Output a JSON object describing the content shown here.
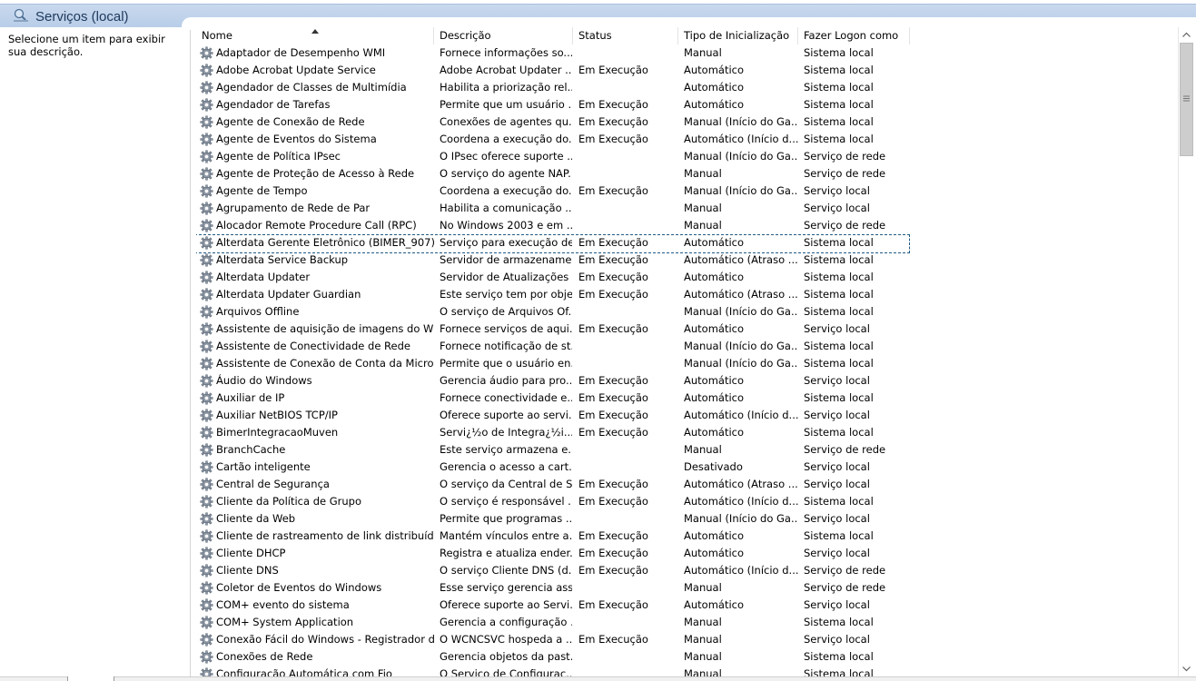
{
  "header": {
    "title": "Serviços (local)",
    "icon": "services-magnifier-icon"
  },
  "description_pane": {
    "text": "Selecione um item para exibir sua descrição."
  },
  "columns": [
    "Nome",
    "Descrição",
    "Status",
    "Tipo de Inicialização",
    "Fazer Logon como"
  ],
  "sort": {
    "column": "Nome",
    "direction": "ascending"
  },
  "rows": [
    {
      "name": "Adaptador de Desempenho WMI",
      "desc": "Fornece informações so...",
      "status": "",
      "start": "Manual",
      "logon": "Sistema local"
    },
    {
      "name": "Adobe Acrobat Update Service",
      "desc": "Adobe Acrobat Updater ...",
      "status": "Em Execução",
      "start": "Automático",
      "logon": "Sistema local"
    },
    {
      "name": "Agendador de Classes de Multimídia",
      "desc": "Habilita a priorização rel...",
      "status": "",
      "start": "Automático",
      "logon": "Sistema local"
    },
    {
      "name": "Agendador de Tarefas",
      "desc": "Permite que um usuário ...",
      "status": "Em Execução",
      "start": "Automático",
      "logon": "Sistema local"
    },
    {
      "name": "Agente de Conexão de Rede",
      "desc": "Conexões de agentes qu...",
      "status": "Em Execução",
      "start": "Manual (Início do Ga...",
      "logon": "Sistema local"
    },
    {
      "name": "Agente de Eventos do Sistema",
      "desc": "Coordena a execução do...",
      "status": "Em Execução",
      "start": "Automático (Início d...",
      "logon": "Sistema local"
    },
    {
      "name": "Agente de Política IPsec",
      "desc": "O IPsec oferece suporte ...",
      "status": "",
      "start": "Manual (Início do Ga...",
      "logon": "Serviço de rede"
    },
    {
      "name": "Agente de Proteção de Acesso à Rede",
      "desc": "O serviço do agente NAP...",
      "status": "",
      "start": "Manual",
      "logon": "Serviço de rede"
    },
    {
      "name": "Agente de Tempo",
      "desc": "Coordena a execução do...",
      "status": "Em Execução",
      "start": "Manual (Início do Ga...",
      "logon": "Serviço local"
    },
    {
      "name": "Agrupamento de Rede de Par",
      "desc": "Habilita a comunicação ...",
      "status": "",
      "start": "Manual",
      "logon": "Serviço local"
    },
    {
      "name": "Alocador Remote Procedure Call (RPC)",
      "desc": "No Windows 2003 e em ...",
      "status": "",
      "start": "Manual",
      "logon": "Serviço de rede"
    },
    {
      "name": "Alterdata Gerente Eletrônico (BIMER_907)",
      "desc": "Serviço para execução de...",
      "status": "Em Execução",
      "start": "Automático",
      "logon": "Sistema local",
      "focused": true
    },
    {
      "name": "Alterdata Service Backup",
      "desc": "Servidor de armazename...",
      "status": "Em Execução",
      "start": "Automático (Atraso ...",
      "logon": "Sistema local"
    },
    {
      "name": "Alterdata Updater",
      "desc": "Servidor de Atualizações ...",
      "status": "Em Execução",
      "start": "Automático",
      "logon": "Sistema local"
    },
    {
      "name": "Alterdata Updater Guardian",
      "desc": "Este serviço tem por obje...",
      "status": "Em Execução",
      "start": "Automático (Atraso ...",
      "logon": "Sistema local"
    },
    {
      "name": "Arquivos Offline",
      "desc": "O serviço de Arquivos Of...",
      "status": "",
      "start": "Manual (Início do Ga...",
      "logon": "Sistema local"
    },
    {
      "name": "Assistente de aquisição de imagens do Win...",
      "desc": "Fornece serviços de aqui...",
      "status": "Em Execução",
      "start": "Automático",
      "logon": "Serviço local"
    },
    {
      "name": "Assistente de Conectividade de Rede",
      "desc": "Fornece notificação de st...",
      "status": "",
      "start": "Manual (Início do Ga...",
      "logon": "Sistema local"
    },
    {
      "name": "Assistente de Conexão de Conta da Micros...",
      "desc": "Permite que o usuário en...",
      "status": "",
      "start": "Manual (Início do Ga...",
      "logon": "Sistema local"
    },
    {
      "name": "Áudio do Windows",
      "desc": "Gerencia áudio para pro...",
      "status": "Em Execução",
      "start": "Automático",
      "logon": "Serviço local"
    },
    {
      "name": "Auxiliar de IP",
      "desc": "Fornece conectividade e...",
      "status": "Em Execução",
      "start": "Automático",
      "logon": "Sistema local"
    },
    {
      "name": "Auxiliar NetBIOS TCP/IP",
      "desc": "Oferece suporte ao servi...",
      "status": "Em Execução",
      "start": "Automático (Início d...",
      "logon": "Serviço local"
    },
    {
      "name": "BimerIntegracaoMuven",
      "desc": "Servi¿½o de Integra¿½i...",
      "status": "Em Execução",
      "start": "Automático",
      "logon": "Sistema local"
    },
    {
      "name": "BranchCache",
      "desc": "Este serviço armazena e...",
      "status": "",
      "start": "Manual",
      "logon": "Serviço de rede"
    },
    {
      "name": "Cartão inteligente",
      "desc": "Gerencia o acesso a cart...",
      "status": "",
      "start": "Desativado",
      "logon": "Serviço local"
    },
    {
      "name": "Central de Segurança",
      "desc": "O serviço da Central de S...",
      "status": "Em Execução",
      "start": "Automático (Atraso ...",
      "logon": "Serviço local"
    },
    {
      "name": "Cliente da Política de Grupo",
      "desc": "O serviço é responsável ...",
      "status": "Em Execução",
      "start": "Automático (Início d...",
      "logon": "Sistema local"
    },
    {
      "name": "Cliente da Web",
      "desc": "Permite que programas ...",
      "status": "",
      "start": "Manual (Início do Ga...",
      "logon": "Serviço local"
    },
    {
      "name": "Cliente de rastreamento de link distribuído",
      "desc": "Mantém vínculos entre a...",
      "status": "Em Execução",
      "start": "Automático",
      "logon": "Sistema local"
    },
    {
      "name": "Cliente DHCP",
      "desc": "Registra e atualiza ender...",
      "status": "Em Execução",
      "start": "Automático",
      "logon": "Serviço local"
    },
    {
      "name": "Cliente DNS",
      "desc": "O serviço Cliente DNS (d...",
      "status": "Em Execução",
      "start": "Automático (Início d...",
      "logon": "Serviço de rede"
    },
    {
      "name": "Coletor de Eventos do Windows",
      "desc": "Esse serviço gerencia assi...",
      "status": "",
      "start": "Manual",
      "logon": "Serviço de rede"
    },
    {
      "name": "COM+ evento do sistema",
      "desc": "Oferece suporte ao Servi...",
      "status": "Em Execução",
      "start": "Automático",
      "logon": "Serviço local"
    },
    {
      "name": "COM+ System Application",
      "desc": "Gerencia a configuração ...",
      "status": "",
      "start": "Manual",
      "logon": "Sistema local"
    },
    {
      "name": "Conexão Fácil do Windows - Registrador de...",
      "desc": "O WCNCSVC hospeda a ...",
      "status": "Em Execução",
      "start": "Manual",
      "logon": "Serviço local"
    },
    {
      "name": "Conexões de Rede",
      "desc": "Gerencia objetos da past...",
      "status": "",
      "start": "Manual",
      "logon": "Sistema local"
    },
    {
      "name": "Configuração Automática com Fio",
      "desc": "O Serviço de Configurac...",
      "status": "",
      "start": "Manual",
      "logon": "Sistema local"
    }
  ],
  "row_icon": "service-gear-icon",
  "scrollbar": {
    "up_icon": "scroll-up-arrow-icon",
    "down_icon": "scroll-down-arrow-icon"
  }
}
